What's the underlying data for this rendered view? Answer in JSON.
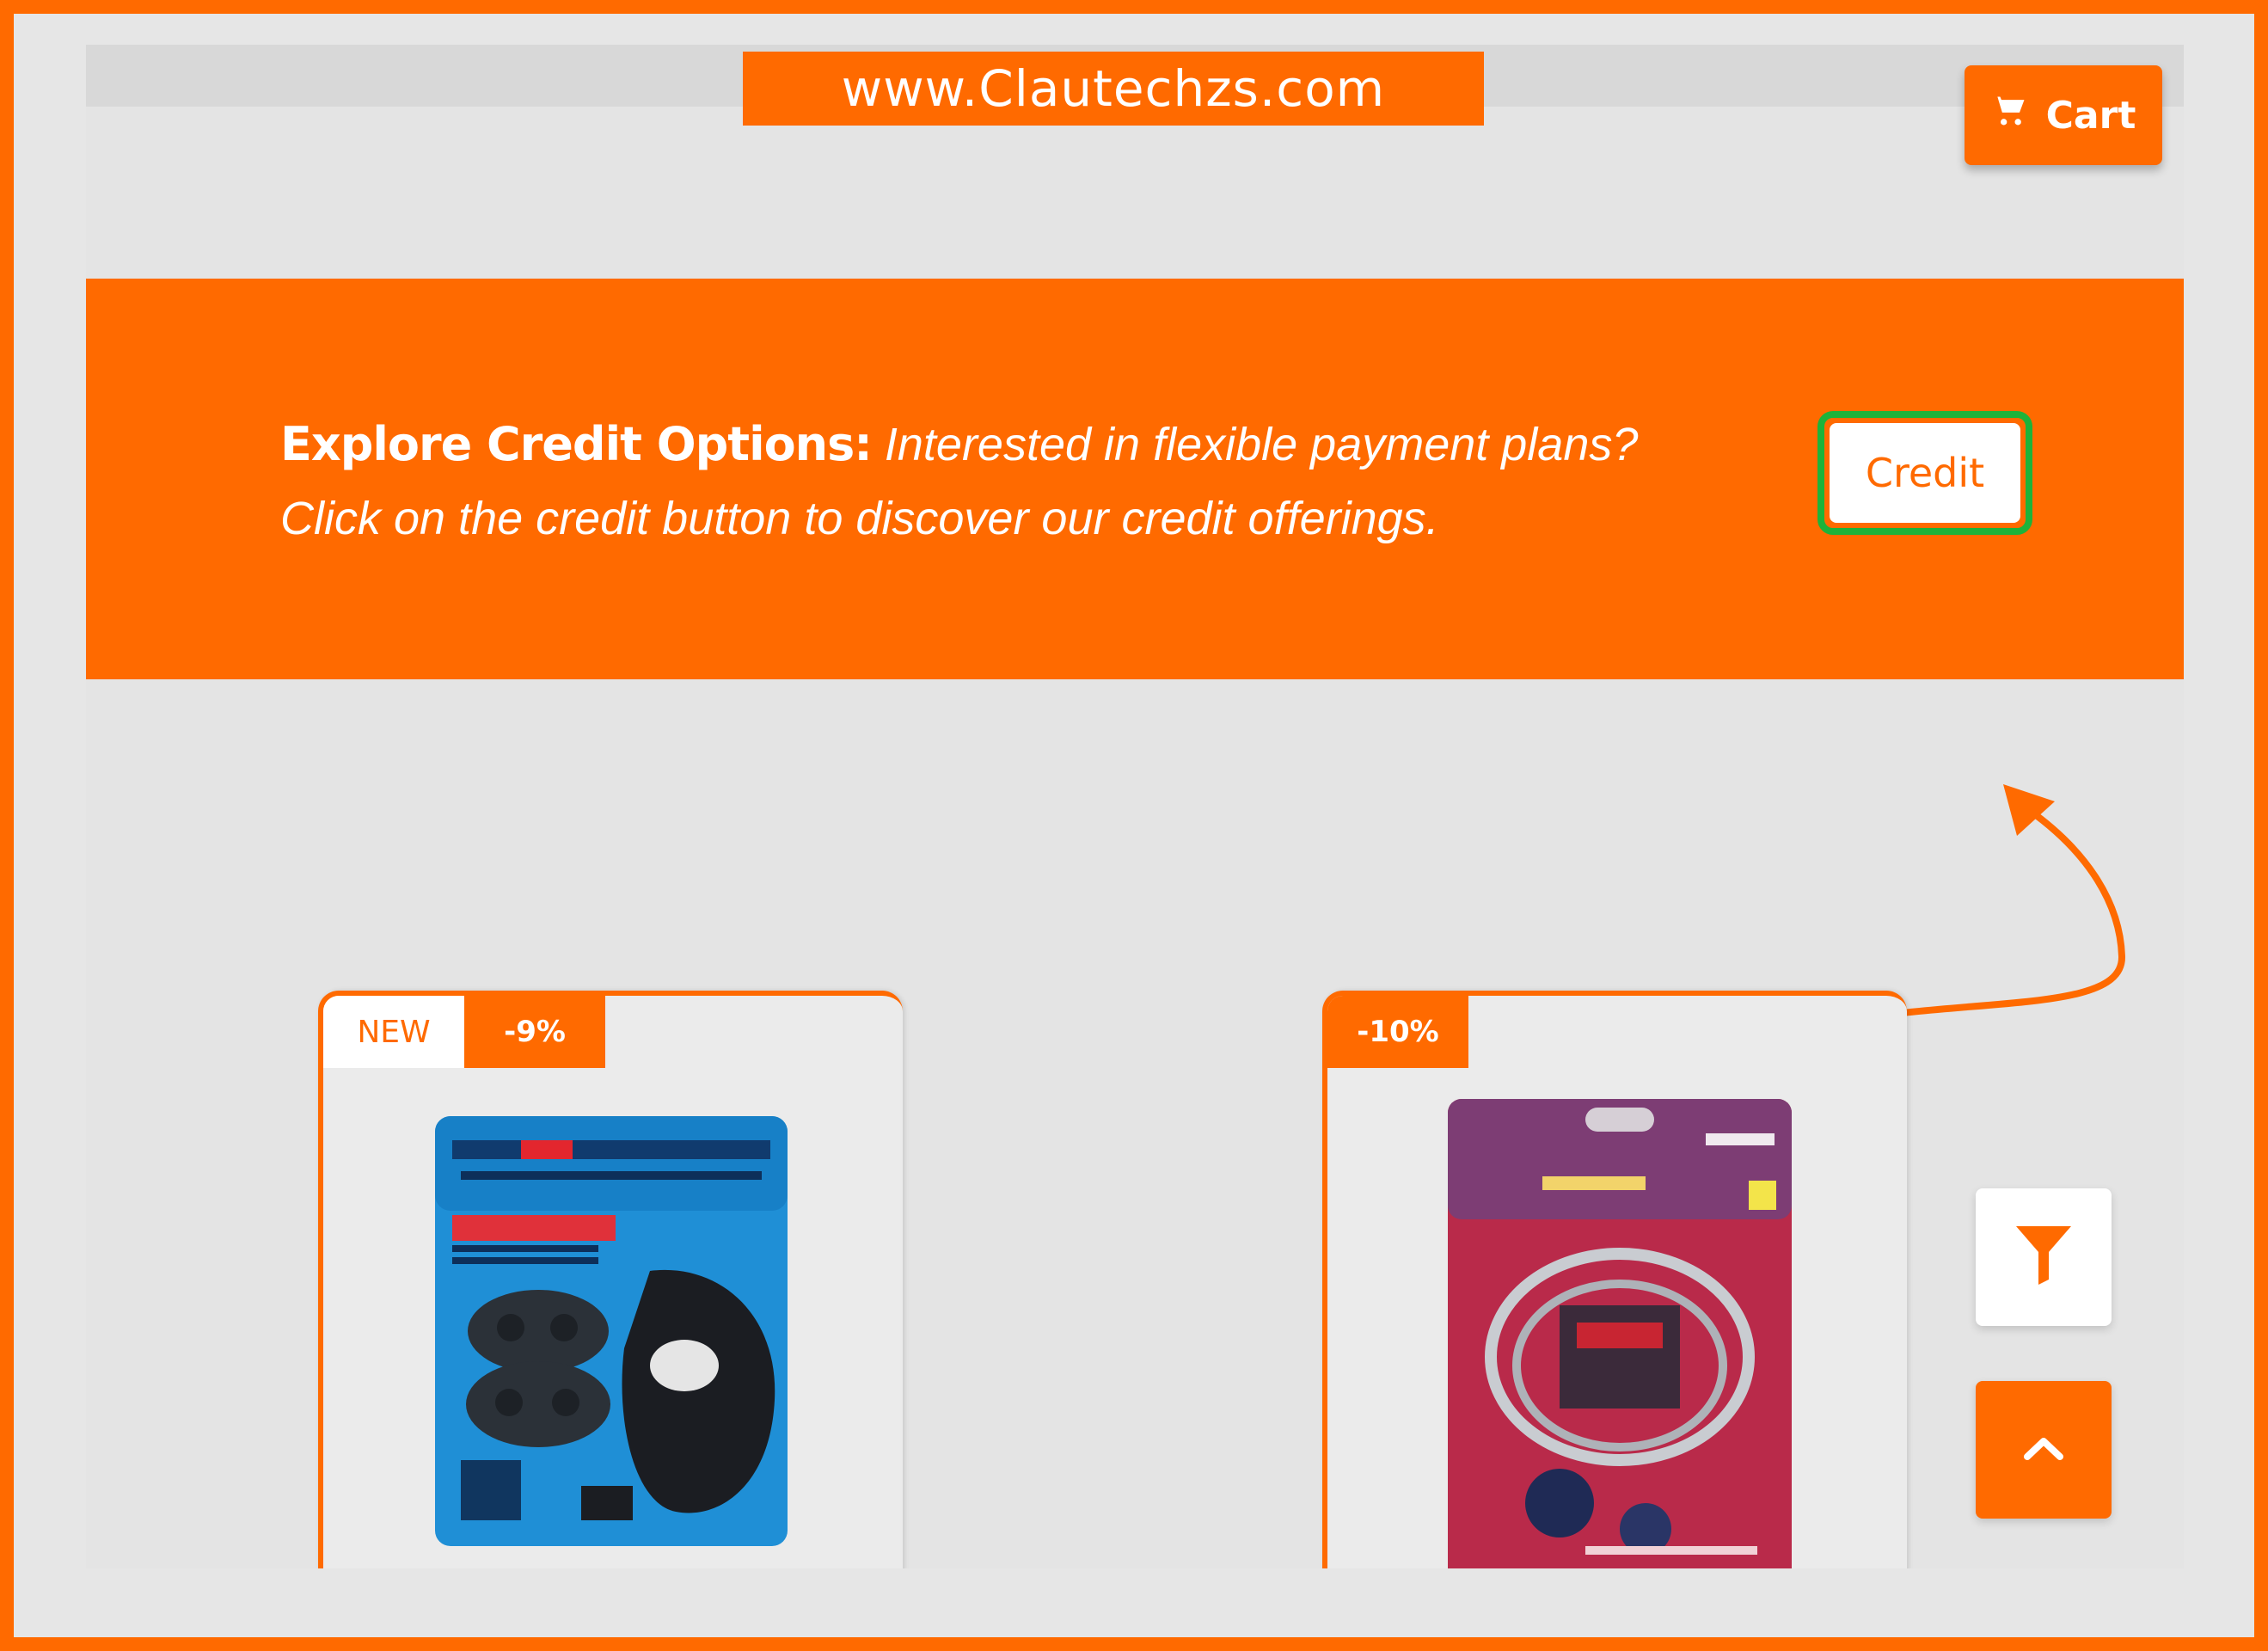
{
  "site": {
    "url_banner": "www.Clautechzs.com"
  },
  "header": {
    "cart_label": "Cart"
  },
  "promo": {
    "title": "Explore Credit Options:",
    "line1": "Interested in flexible payment plans?",
    "line2": "Click on the credit button to discover our credit offerings.",
    "button_label": "Credit"
  },
  "products": [
    {
      "badge_new": "NEW",
      "discount": "-9%",
      "image": "wireless-controller-package"
    },
    {
      "discount": "-10%",
      "image": "cable-lock-package"
    }
  ],
  "icons": {
    "cart": "cart-icon",
    "filter": "filter-icon",
    "scroll_top": "chevron-up-icon"
  },
  "colors": {
    "accent": "#ff6a00",
    "highlight": "#1db33a",
    "background": "#e4e4e4"
  }
}
